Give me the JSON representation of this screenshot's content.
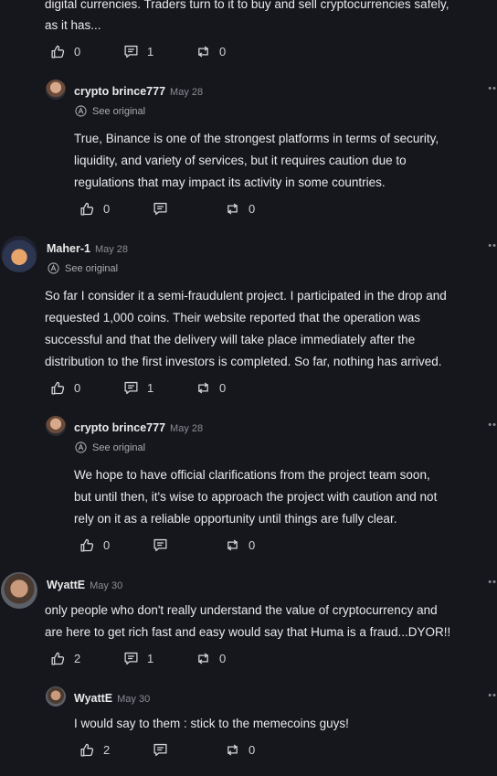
{
  "post0": {
    "text_line1": "digital currencies. Traders turn to it to buy and sell cryptocurrencies safely,",
    "text_line2": "as it has...",
    "likes": "0",
    "comments": "1",
    "reposts": "0"
  },
  "reply1": {
    "author": "crypto brince777",
    "date": "May 28",
    "see_original": "See original",
    "text_line1": "True, Binance is one of the strongest platforms in terms of security,",
    "text_line2": "liquidity, and variety of services, but it requires caution due to",
    "text_line3": "regulations that may impact its activity in some countries.",
    "likes": "0",
    "reposts": "0"
  },
  "post2": {
    "author": "Maher-1",
    "date": "May 28",
    "see_original": "See original",
    "text_line1": "So far I consider it a semi-fraudulent project. I participated in the drop and",
    "text_line2": "requested 1,000 coins. Their website reported that the operation was",
    "text_line3": "successful and that the delivery will take place immediately after the",
    "text_line4": "distribution to the first investors is completed. So far, nothing has arrived.",
    "likes": "0",
    "comments": "1",
    "reposts": "0"
  },
  "reply2": {
    "author": "crypto brince777",
    "date": "May 28",
    "see_original": "See original",
    "text_line1": "We hope to have official clarifications from the project team soon,",
    "text_line2": "but until then, it's wise to approach the project with caution and not",
    "text_line3": "rely on it as a reliable opportunity until things are fully clear.",
    "likes": "0",
    "reposts": "0"
  },
  "post3": {
    "author": "WyattE",
    "date": "May 30",
    "text_line1": "only people who don't really understand the value of cryptocurrency and",
    "text_line2": "are here to get rich fast and easy would say that Huma is a fraud...DYOR!!",
    "likes": "2",
    "comments": "1",
    "reposts": "0"
  },
  "reply3": {
    "author": "WyattE",
    "date": "May 30",
    "text_line1": "I would say to them : stick to the memecoins guys!",
    "likes": "2",
    "reposts": "0"
  },
  "icons": {
    "like": "thumbs-up-icon",
    "comment": "comment-icon",
    "repost": "repost-icon",
    "translate": "translate-icon",
    "more": "more-options-icon"
  },
  "colors": {
    "background": "#16171c",
    "text": "#eaeaec",
    "muted": "#8b8d94"
  }
}
